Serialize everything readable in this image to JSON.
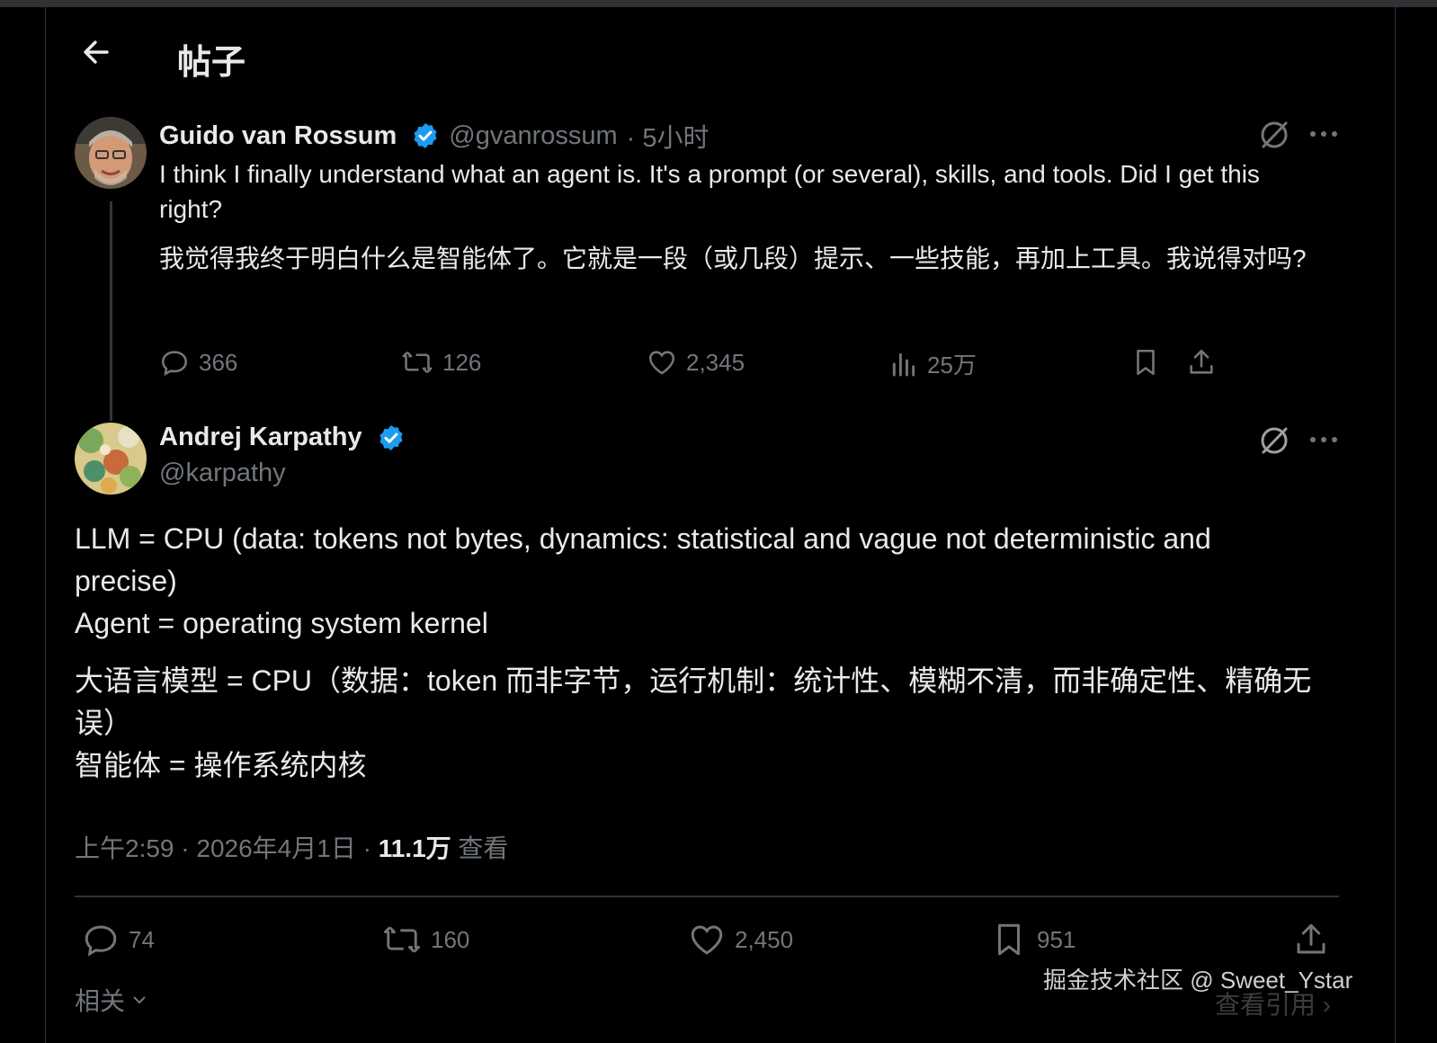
{
  "header": {
    "title": "帖子"
  },
  "parent_post": {
    "author_name": "Guido van Rossum",
    "handle": "@gvanrossum",
    "time": "· 5小时",
    "text_en": "I think I finally understand what an agent is. It's a prompt (or several), skills, and tools. Did I get this right?",
    "text_zh": "我觉得我终于明白什么是智能体了。它就是一段（或几段）提示、一些技能，再加上工具。我说得对吗?",
    "stats": {
      "replies": "366",
      "reposts": "126",
      "likes": "2,345",
      "views": "25万"
    }
  },
  "main_post": {
    "author_name": "Andrej Karpathy",
    "handle": "@karpathy",
    "text_en_1": "LLM = CPU (data: tokens not bytes, dynamics: statistical and vague not deterministic and precise)",
    "text_en_2": "Agent = operating system kernel",
    "text_zh_1": "大语言模型 = CPU（数据：token 而非字节，运行机制：统计性、模糊不清，而非确定性、精确无误）",
    "text_zh_2": "智能体 = 操作系统内核",
    "timestamp": "上午2:59 · 2026年4月1日 · ",
    "views_count": "11.1万",
    "views_label": " 查看",
    "stats": {
      "replies": "74",
      "reposts": "160",
      "likes": "2,450",
      "bookmarks": "951"
    }
  },
  "footer": {
    "related_label": "相关",
    "quote_label": "查看引用",
    "watermark": "掘金技术社区 @ Sweet_Ystar"
  },
  "colors": {
    "background": "#000000",
    "text": "#e7e9ea",
    "muted": "#71767b",
    "verified": "#1d9bf0",
    "divider": "#2f3336"
  }
}
